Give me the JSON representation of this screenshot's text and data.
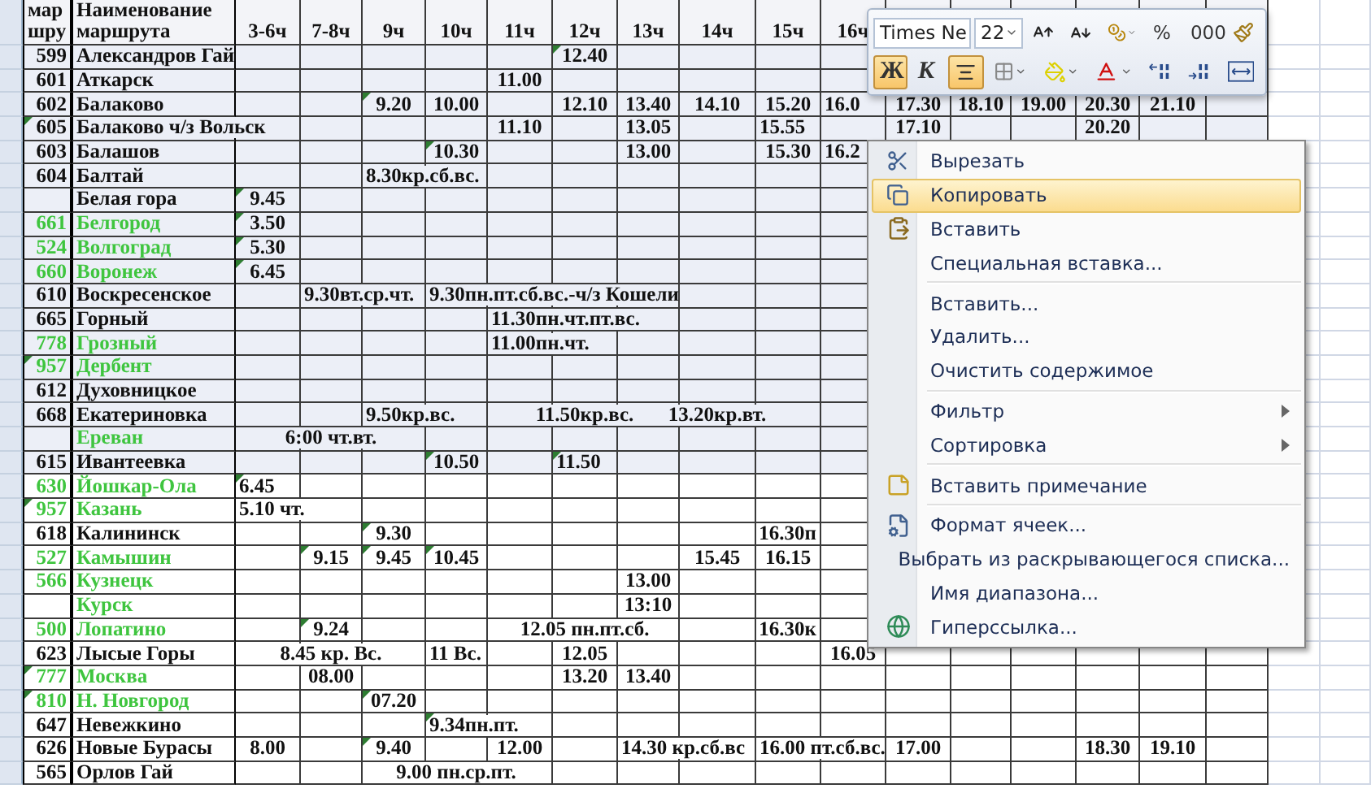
{
  "sheet": {
    "number_header": "мар шру",
    "name_header": "Наименование маршрута",
    "columns": [
      "3-6ч",
      "7-8ч",
      "9ч",
      "10ч",
      "11ч",
      "12ч",
      "13ч",
      "14ч",
      "15ч",
      "16ч"
    ],
    "rows": [
      {
        "number": "599",
        "name": "Александров Гай",
        "green": false,
        "shaded": true,
        "number_comment": false,
        "cells": [
          null,
          null,
          null,
          null,
          null,
          {
            "text": "12.40",
            "comment": true
          }
        ]
      },
      {
        "number": "601",
        "name": "Аткарск",
        "green": false,
        "shaded": true,
        "number_comment": false,
        "cells": [
          null,
          null,
          null,
          null,
          {
            "text": "11.00"
          }
        ]
      },
      {
        "number": "602",
        "name": "Балаково",
        "green": false,
        "shaded": true,
        "number_comment": false,
        "cells": [
          null,
          null,
          {
            "text": "9.20",
            "comment": true
          },
          {
            "text": "10.00"
          },
          null,
          {
            "text": "12.10"
          },
          {
            "text": "13.40"
          },
          {
            "text": "14.10"
          },
          {
            "text": "15.20"
          },
          {
            "text": "16.0",
            "kind": "spill"
          },
          {
            "text": "17.30"
          },
          {
            "text": "18.10"
          },
          {
            "text": "19.00"
          },
          {
            "text": "20.30"
          },
          {
            "text": "21.10"
          }
        ]
      },
      {
        "number": "605",
        "name": "Балаково ч/з Вольск",
        "green": false,
        "shaded": true,
        "number_comment": true,
        "cells": [
          null,
          null,
          null,
          null,
          {
            "text": "11.10"
          },
          null,
          {
            "text": "13.05"
          },
          null,
          {
            "text": "15.55",
            "kind": "spill"
          },
          null,
          {
            "text": "17.10"
          },
          null,
          null,
          {
            "text": "20.20"
          }
        ]
      },
      {
        "number": "603",
        "name": "Балашов",
        "green": false,
        "shaded": true,
        "number_comment": false,
        "cells": [
          null,
          null,
          null,
          {
            "text": "10.30",
            "comment": true
          },
          null,
          null,
          {
            "text": "13.00"
          },
          null,
          {
            "text": "15.30"
          },
          {
            "text": "16.2",
            "kind": "spill"
          }
        ]
      },
      {
        "number": "604",
        "name": "Балтай",
        "green": false,
        "shaded": true,
        "number_comment": false,
        "cells": [
          null,
          null,
          {
            "text": "8.30кр.сб.вс.",
            "kind": "spill"
          }
        ]
      },
      {
        "name": "Белая гора",
        "green": false,
        "shaded": true,
        "number_comment": false,
        "cells": [
          {
            "text": "9.45",
            "comment": true
          }
        ]
      },
      {
        "number": "661",
        "name": "Белгород",
        "green": true,
        "shaded": true,
        "number_comment": false,
        "cells": [
          {
            "text": "3.50",
            "comment": true
          }
        ]
      },
      {
        "number": "524",
        "name": "Волгоград",
        "green": true,
        "shaded": true,
        "number_comment": false,
        "cells": [
          {
            "text": "5.30",
            "comment": true
          }
        ]
      },
      {
        "number": "660",
        "name": "Воронеж",
        "green": true,
        "shaded": true,
        "number_comment": false,
        "cells": [
          {
            "text": "6.45",
            "comment": true
          }
        ]
      },
      {
        "number": "610",
        "name": "Воскресенское",
        "green": false,
        "shaded": true,
        "number_comment": false,
        "cells": [
          null,
          {
            "text": "9.30вт.ср.чт.",
            "kind": "spill"
          },
          null,
          {
            "text": "9.30пн.пт.сб.вс.-ч/з Кошели",
            "kind": "spill"
          }
        ]
      },
      {
        "number": "665",
        "name": "Горный",
        "green": false,
        "shaded": true,
        "number_comment": false,
        "cells": [
          null,
          null,
          null,
          null,
          {
            "text": "11.30пн.чт.пт.вс.",
            "kind": "spill"
          }
        ]
      },
      {
        "number": "778",
        "name": "Грозный",
        "green": true,
        "shaded": true,
        "number_comment": false,
        "cells": [
          null,
          null,
          null,
          null,
          {
            "text": "11.00пн.чт.",
            "kind": "spill"
          }
        ]
      },
      {
        "number": "957",
        "name": "Дербент",
        "green": true,
        "shaded": true,
        "number_comment": true,
        "cells": []
      },
      {
        "number": "612",
        "name": "Духовницкое",
        "green": false,
        "shaded": true,
        "number_comment": false,
        "cells": []
      },
      {
        "number": "668",
        "name": "Екатериновка",
        "green": false,
        "shaded": true,
        "number_comment": false,
        "cells": [
          null,
          null,
          {
            "text": "9.50кр.вс.",
            "kind": "spill"
          },
          null,
          null,
          {
            "text": "11.50кр.вс."
          },
          null,
          {
            "text": "13.20кр.вт."
          }
        ]
      },
      {
        "name": "Ереван",
        "green": true,
        "shaded": true,
        "number_comment": false,
        "cells": [
          null,
          {
            "text": "6:00 чт.вт."
          }
        ]
      },
      {
        "number": "615",
        "name": "Ивантеевка",
        "green": false,
        "shaded": true,
        "number_comment": false,
        "cells": [
          null,
          null,
          null,
          {
            "text": "10.50",
            "comment": true
          },
          null,
          {
            "text": "11.50",
            "comment": true,
            "kind": "spill"
          }
        ]
      },
      {
        "number": "630",
        "name": "Йошкар-Ола",
        "green": true,
        "shaded": false,
        "number_comment": false,
        "cells": [
          {
            "text": "6.45",
            "comment": true,
            "kind": "spill"
          }
        ]
      },
      {
        "number": "957",
        "name": "Казань",
        "green": true,
        "shaded": false,
        "number_comment": true,
        "cells": [
          {
            "text": "5.10 чт.",
            "kind": "spill"
          }
        ]
      },
      {
        "number": "618",
        "name": "Калининск",
        "green": false,
        "shaded": false,
        "number_comment": false,
        "cells": [
          null,
          null,
          {
            "text": "9.30",
            "comment": true
          },
          null,
          null,
          null,
          null,
          null,
          {
            "text": "16.30п",
            "kind": "end"
          }
        ]
      },
      {
        "number": "527",
        "name": "Камышин",
        "green": true,
        "shaded": false,
        "number_comment": false,
        "cells": [
          null,
          {
            "text": "9.15",
            "comment": true
          },
          {
            "text": "9.45",
            "comment": true
          },
          {
            "text": "10.45",
            "comment": true
          },
          null,
          null,
          null,
          {
            "text": "15.45"
          },
          {
            "text": "16.15"
          }
        ]
      },
      {
        "number": "566",
        "name": "Кузнецк",
        "green": true,
        "shaded": false,
        "number_comment": false,
        "cells": [
          null,
          null,
          null,
          null,
          null,
          null,
          {
            "text": "13.00"
          }
        ]
      },
      {
        "name": "Курск",
        "green": true,
        "shaded": false,
        "number_comment": false,
        "cells": [
          null,
          null,
          null,
          null,
          null,
          null,
          {
            "text": "13:10"
          }
        ]
      },
      {
        "number": "500",
        "name": "Лопатино",
        "green": true,
        "shaded": false,
        "number_comment": false,
        "cells": [
          null,
          {
            "text": "9.24",
            "comment": true
          },
          null,
          null,
          null,
          {
            "text": "12.05 пн.пт.сб."
          },
          null,
          null,
          {
            "text": "16.30к",
            "kind": "end"
          }
        ]
      },
      {
        "number": "623",
        "name": "Лысые Горы",
        "green": false,
        "shaded": false,
        "number_comment": false,
        "cells": [
          null,
          {
            "text": "8.45 кр. Вс."
          },
          null,
          {
            "text": "11 Вс.",
            "kind": "spill"
          },
          null,
          {
            "text": "12.05"
          },
          null,
          null,
          null,
          {
            "text": "16.05"
          }
        ]
      },
      {
        "number": "777",
        "name": "Москва",
        "green": true,
        "shaded": false,
        "number_comment": true,
        "cells": [
          null,
          {
            "text": "08.00"
          },
          null,
          null,
          null,
          {
            "text": "13.20"
          },
          {
            "text": "13.40"
          }
        ]
      },
      {
        "number": "810",
        "name": "Н. Новгород",
        "green": true,
        "shaded": false,
        "number_comment": true,
        "cells": [
          null,
          null,
          {
            "text": "07.20",
            "comment": true
          }
        ]
      },
      {
        "number": "647",
        "name": "Невежкино",
        "green": false,
        "shaded": false,
        "number_comment": false,
        "cells": [
          null,
          null,
          null,
          {
            "text": "9.34пн.пт.",
            "kind": "spill",
            "comment": true
          }
        ]
      },
      {
        "number": "626",
        "name": "Новые Бурасы",
        "green": false,
        "shaded": false,
        "number_comment": false,
        "cells": [
          {
            "text": "8.00"
          },
          null,
          {
            "text": "9.40",
            "comment": true
          },
          null,
          {
            "text": "12.00"
          },
          null,
          {
            "text": "14.30 кр.сб.вс",
            "kind": "spill"
          },
          null,
          {
            "text": "16.00 пт.сб.вс.",
            "kind": "spill"
          },
          null,
          {
            "text": "17.00"
          },
          null,
          null,
          {
            "text": "18.30"
          },
          {
            "text": "19.10"
          }
        ]
      },
      {
        "number": "565",
        "name": "Орлов Гай",
        "green": false,
        "shaded": false,
        "number_comment": false,
        "cells": [
          null,
          null,
          null,
          {
            "text": "9.00 пн.ср.пт."
          }
        ]
      }
    ]
  },
  "mini_toolbar": {
    "font": "Times Ne",
    "size": "22",
    "top_row": [
      {
        "kind": "grow",
        "selected": false,
        "dropdown": false
      },
      {
        "kind": "shrink",
        "selected": false,
        "dropdown": false
      },
      {
        "kind": "currency",
        "selected": false,
        "dropdown": true
      },
      {
        "kind": "text",
        "label": "%",
        "selected": false,
        "dropdown": false
      },
      {
        "kind": "text",
        "label": "000",
        "selected": false,
        "dropdown": false
      },
      {
        "kind": "painter",
        "selected": false,
        "dropdown": false
      }
    ],
    "bottom_row": [
      {
        "kind": "bold",
        "label": "Ж",
        "selected": true,
        "dropdown": false
      },
      {
        "kind": "italic",
        "label": "К",
        "selected": false,
        "dropdown": false
      },
      {
        "kind": "center",
        "selected": true,
        "dropdown": false
      },
      {
        "kind": "borders",
        "selected": false,
        "dropdown": true
      },
      {
        "kind": "fill",
        "selected": false,
        "dropdown": true
      },
      {
        "kind": "color",
        "selected": false,
        "dropdown": true
      },
      {
        "kind": "more-decimals",
        "selected": false,
        "dropdown": false
      },
      {
        "kind": "fewer-decimals",
        "selected": false,
        "dropdown": false
      },
      {
        "kind": "merge",
        "selected": false,
        "dropdown": false
      }
    ]
  },
  "context_menu": {
    "groups": [
      [
        {
          "label": "Вырезать",
          "kind": "cut",
          "selected": false,
          "submenu": false
        },
        {
          "label": "Копировать",
          "kind": "copy",
          "selected": true,
          "submenu": false
        },
        {
          "label": "Вставить",
          "kind": "paste",
          "selected": false,
          "submenu": false
        },
        {
          "label": "Специальная вставка...",
          "kind": "plain",
          "selected": false,
          "submenu": false
        }
      ],
      [
        {
          "label": "Вставить...",
          "kind": "plain",
          "selected": false,
          "submenu": false
        },
        {
          "label": "Удалить...",
          "kind": "plain",
          "selected": false,
          "submenu": false
        },
        {
          "label": "Очистить содержимое",
          "kind": "plain",
          "selected": false,
          "submenu": false
        }
      ],
      [
        {
          "label": "Фильтр",
          "kind": "plain",
          "selected": false,
          "submenu": true
        },
        {
          "label": "Сортировка",
          "kind": "plain",
          "selected": false,
          "submenu": true
        }
      ],
      [
        {
          "label": "Вставить примечание",
          "kind": "note",
          "selected": false,
          "submenu": false
        }
      ],
      [
        {
          "label": "Формат ячеек...",
          "kind": "format",
          "selected": false,
          "submenu": false
        },
        {
          "label": "Выбрать из раскрывающегося списка...",
          "kind": "plain",
          "selected": false,
          "submenu": false
        },
        {
          "label": "Имя диапазона...",
          "kind": "plain",
          "selected": false,
          "submenu": false
        },
        {
          "label": "Гиперссылка...",
          "kind": "link",
          "selected": false,
          "submenu": false
        }
      ]
    ]
  }
}
